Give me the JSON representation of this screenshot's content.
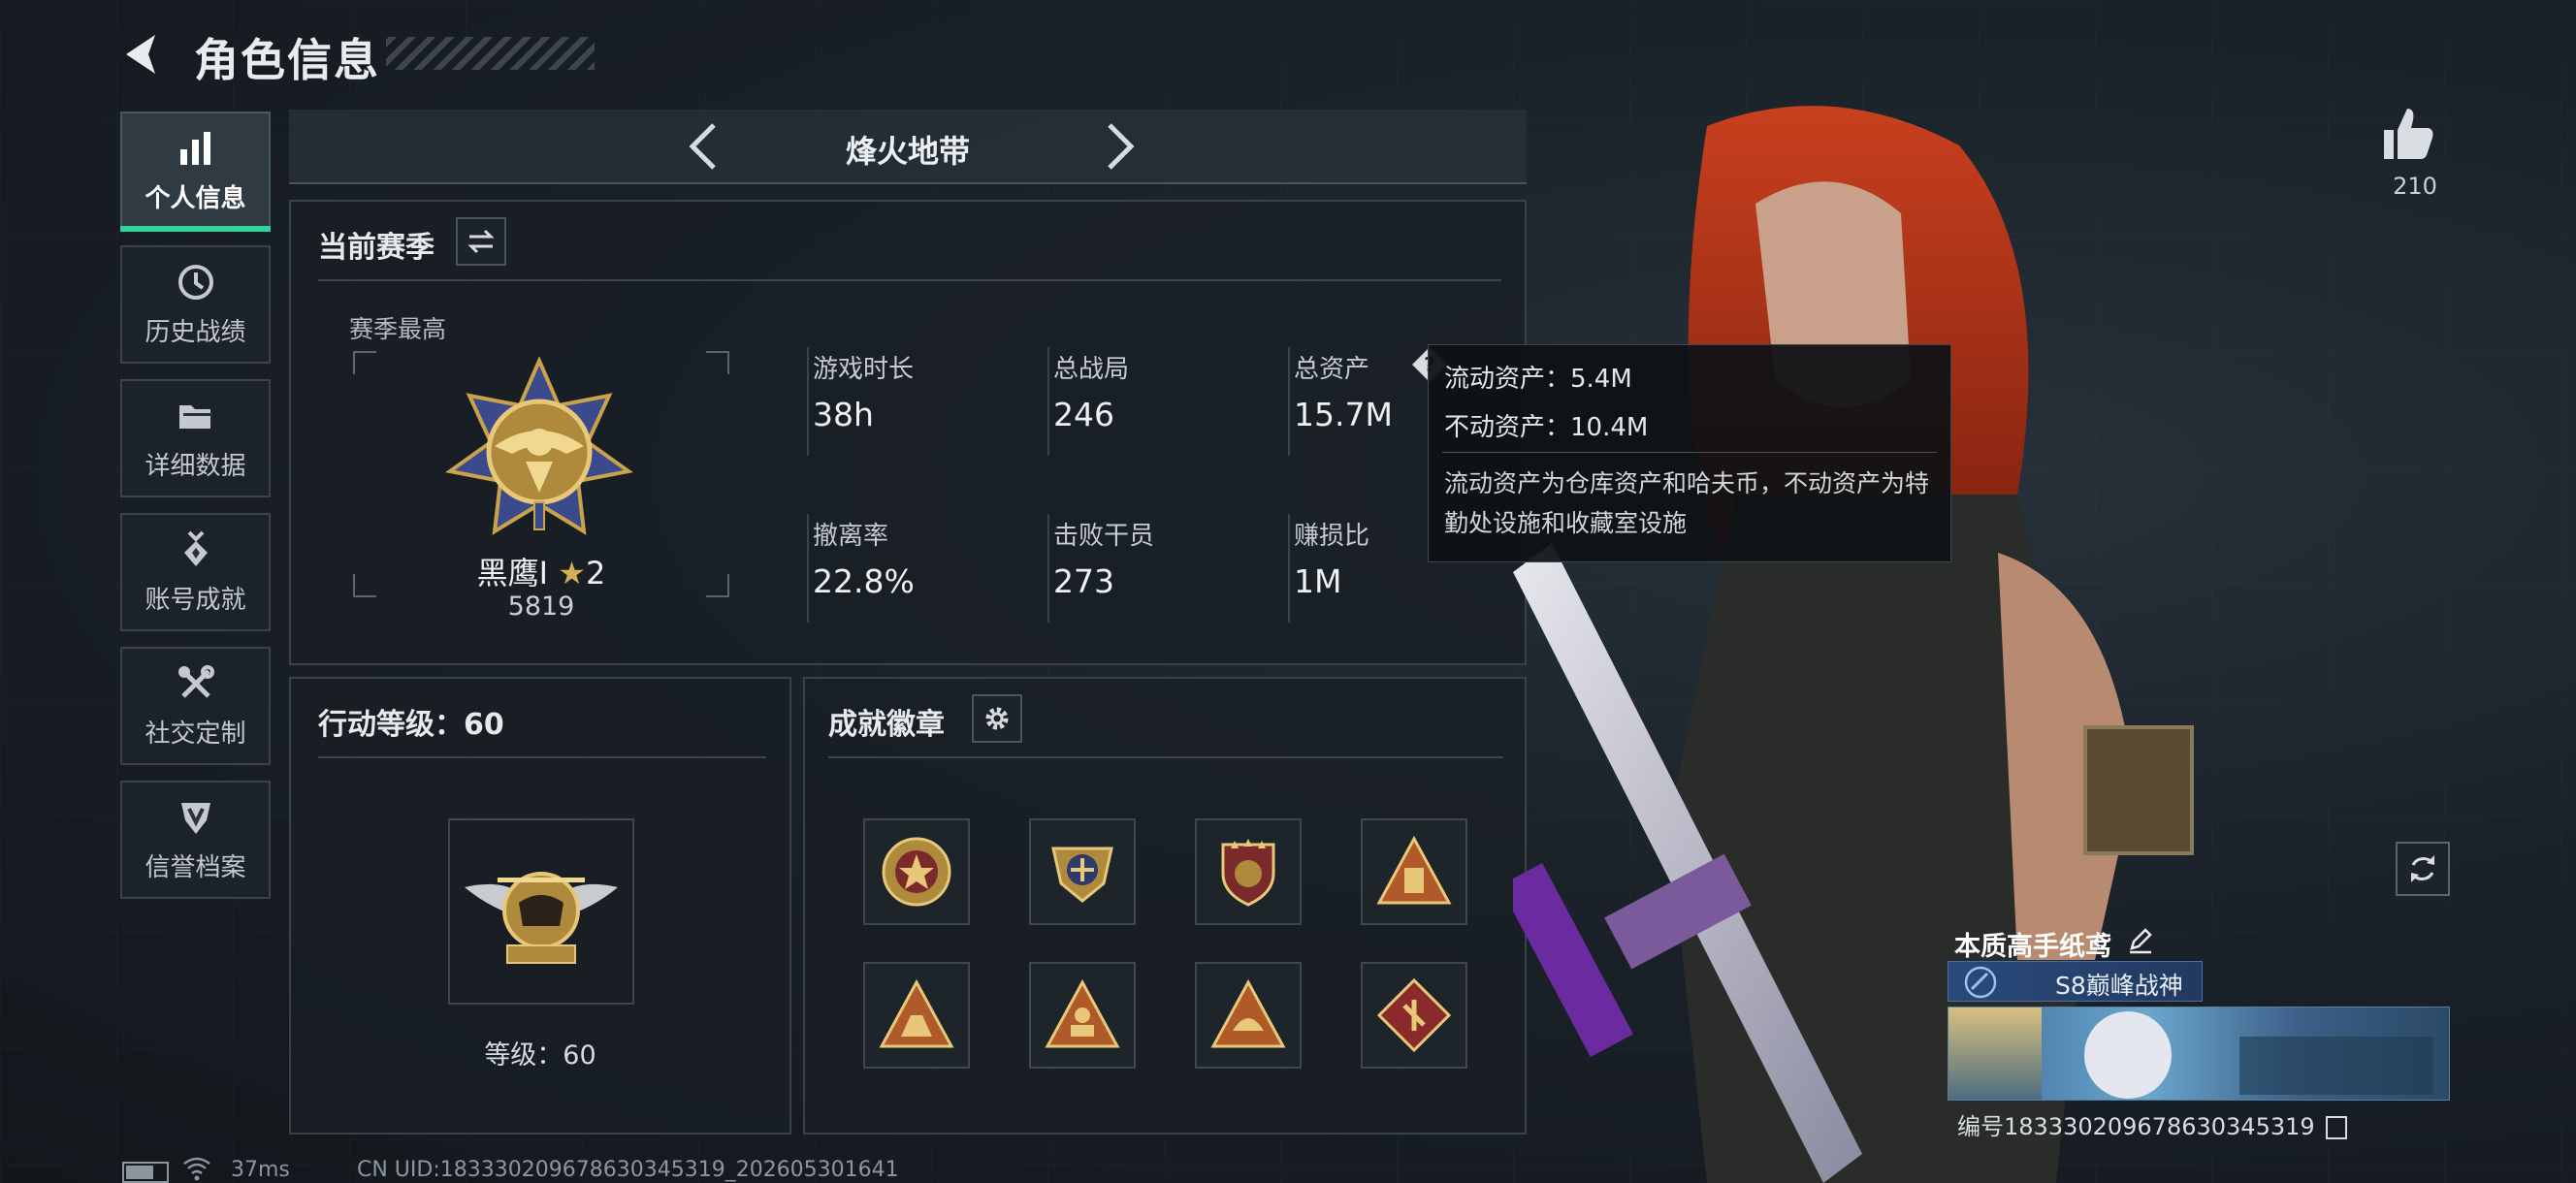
{
  "header": {
    "title": "角色信息"
  },
  "sidebar": {
    "items": [
      {
        "label": "个人信息",
        "icon": "bar-chart-icon",
        "active": true
      },
      {
        "label": "历史战绩",
        "icon": "clock-icon"
      },
      {
        "label": "详细数据",
        "icon": "folder-icon"
      },
      {
        "label": "账号成就",
        "icon": "medal-icon"
      },
      {
        "label": "社交定制",
        "icon": "wrench-icon"
      },
      {
        "label": "信誉档案",
        "icon": "shield-icon"
      }
    ]
  },
  "mode": {
    "title": "烽火地带"
  },
  "season": {
    "title": "当前赛季",
    "best_label": "赛季最高",
    "rank_name": "黑鹰I",
    "rank_stars": "2",
    "rank_score": "5819",
    "stats": [
      {
        "label": "游戏时长",
        "value": "38h"
      },
      {
        "label": "总战局",
        "value": "246"
      },
      {
        "label": "总资产",
        "value": "15.7M"
      },
      {
        "label": "撤离率",
        "value": "22.8%"
      },
      {
        "label": "击败干员",
        "value": "273"
      },
      {
        "label": "赚损比",
        "value": "1M"
      }
    ]
  },
  "tooltip": {
    "liquid": "流动资产：5.4M",
    "fixed": "不动资产：10.4M",
    "desc": "流动资产为仓库资产和哈夫币，不动资产为特勤处设施和收藏室设施"
  },
  "action_level": {
    "title": "行动等级：60",
    "level_text": "等级：60"
  },
  "achievements": {
    "title": "成就徽章"
  },
  "profile": {
    "likes": "210",
    "name": "本质高手纸鸢",
    "title_badge": "S8巅峰战神",
    "id": "编号1833302096786303453​19"
  },
  "footer": {
    "ping": "37ms",
    "uid": "CN UID:183330209678630345319_202605301641"
  },
  "colors": {
    "accent": "#2fd49a",
    "gold": "#c9a24a",
    "bg": "#141a1f"
  }
}
